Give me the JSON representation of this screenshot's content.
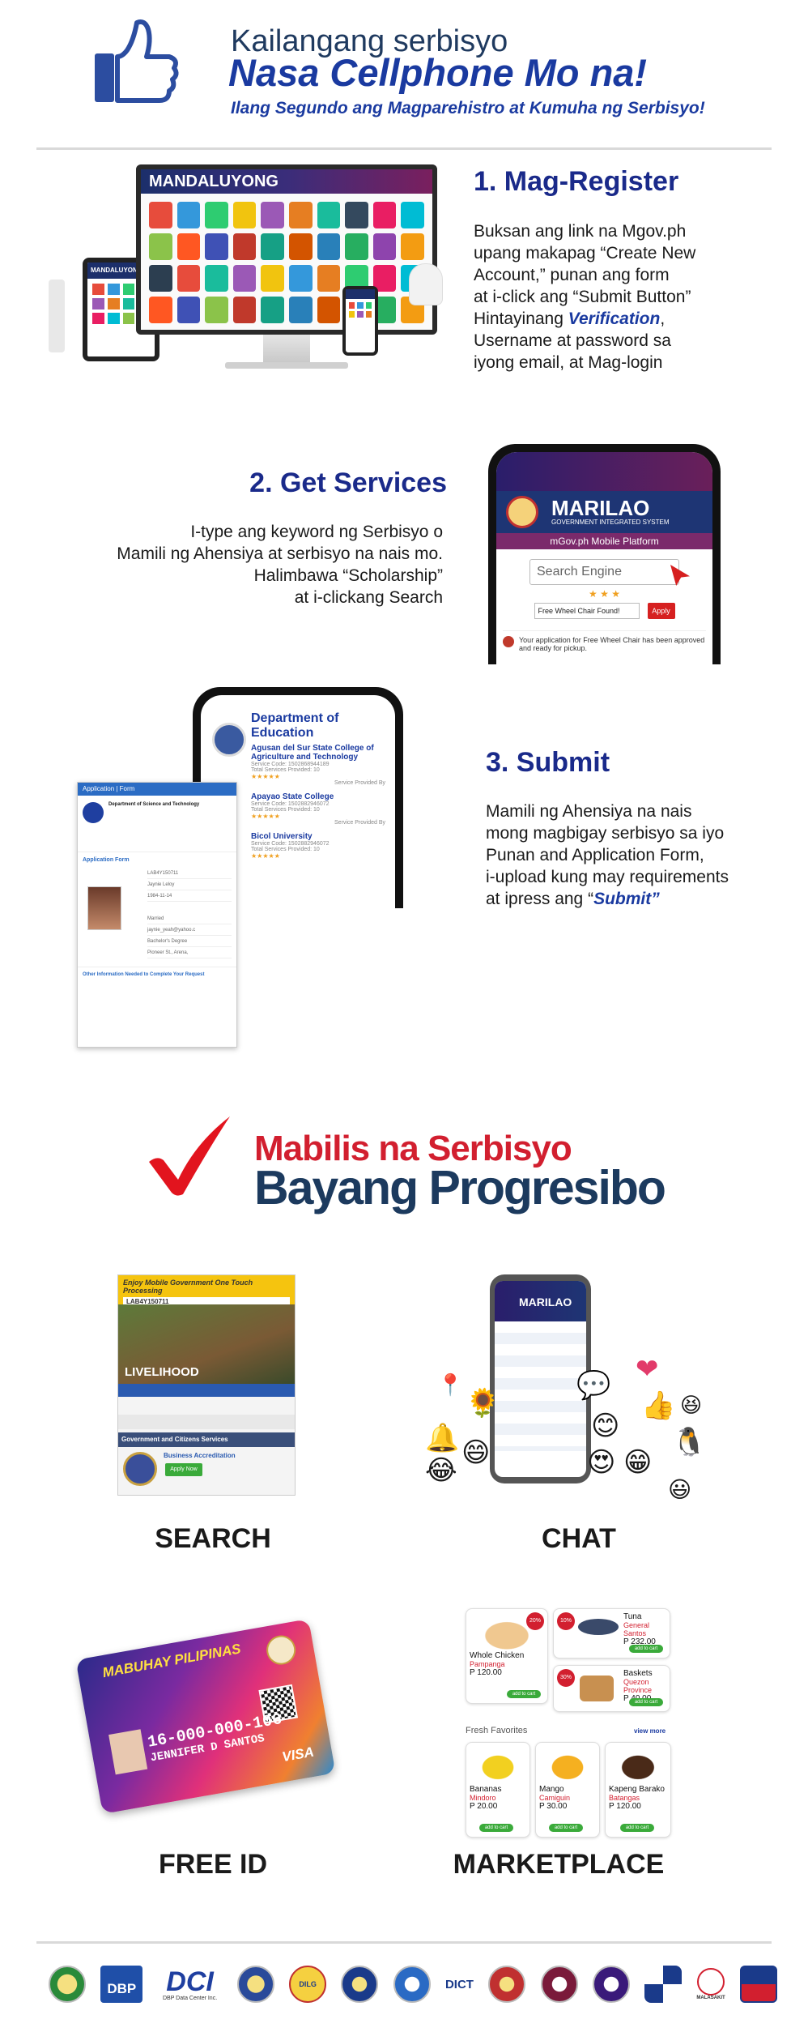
{
  "header": {
    "line1": "Kailangang serbisyo",
    "line2": "Nasa Cellphone Mo na!",
    "line3": "Ilang Segundo ang Magparehistro at Kumuha ng Serbisyo!"
  },
  "step1": {
    "title": "1.  Mag-Register",
    "lines": [
      "Buksan ang link na Mgov.ph",
      "upang makapag “Create New",
      "Account,” punan ang form",
      "at i-click ang “Submit Button”",
      "Username at password sa",
      "iyong email, at Mag-login"
    ],
    "wait_prefix": "Hintayinang ",
    "wait_em": "Verification",
    "wait_suffix": ",",
    "monitor_title": "MANDALUYONG",
    "tablet_title": "MANDALUYONG"
  },
  "step2": {
    "title": "2.  Get Services",
    "lines": [
      "I-type ang keyword ng Serbisyo o",
      "Mamili ng Ahensiya at serbisyo na nais mo.",
      "Halimbawa “Scholarship”",
      "at i-clickang Search"
    ],
    "phone": {
      "brand": "MARILAO",
      "brand_sub": "GOVERNMENT INTEGRATED SYSTEM",
      "platform": "mGov.ph Mobile Platform",
      "search_placeholder": "Search Engine",
      "stars": "★ ★ ★",
      "input_value": "Free Wheel Chair Found!",
      "apply": "Apply",
      "note": "Your application for Free Wheel Chair has been approved and ready for pickup."
    }
  },
  "step3": {
    "title": "3.  Submit",
    "lines": [
      "Mamili ng Ahensiya na nais",
      "mong magbigay serbisyo sa iyo",
      "Punan and Application Form,",
      "i-upload kung may requirements"
    ],
    "last_prefix": "at ipress ang “",
    "last_em": "Submit”",
    "phone": {
      "dept": "Department of Education",
      "items": [
        {
          "name": "Agusan del Sur State College of Agriculture and Technology",
          "code": "Service Code: 1502868944189",
          "total": "Total Services Provided: 10"
        },
        {
          "name": "Apayao State College",
          "code": "Service Code: 1502882946072",
          "total": "Total Services Provided: 10"
        },
        {
          "name": "Bicol University",
          "code": "Service Code: 1502882946072",
          "total": "Total Services Provided: 10"
        }
      ],
      "stars": "★★★★★",
      "provided_by": "Service Provided By"
    },
    "form": {
      "header": "Application | Form",
      "agency": "Department of Science and Technology",
      "section": "Application Form",
      "rows": [
        "LAB4Y150711",
        "Jaynie Leloy",
        "1984-11-14",
        "Married",
        "jaynie_yeah@yahoo.c",
        "Bachelor's Degree",
        "Pioneer St., Arena, "
      ],
      "other": "Other Information Needed to Complete Your Request"
    }
  },
  "slogan": {
    "line1": "Mabilis na Serbisyo",
    "line2": "Bayang Progresibo"
  },
  "features": {
    "search": {
      "label": "SEARCH",
      "banner": "Enjoy Mobile Government One Touch Processing",
      "code": "LAB4Y150711",
      "photo_label": "LIVELIHOOD",
      "section": "Government and Citizens Services",
      "item": "Business Accreditation",
      "apply": "Apply Now"
    },
    "chat": {
      "label": "CHAT",
      "brand": "MARILAO",
      "emojis": [
        "🌻",
        "📍",
        "❤",
        "💬",
        "👍",
        "😊",
        "😄",
        "😍",
        "😂",
        "🐧",
        "🔔",
        "😁",
        "😃",
        "😆"
      ]
    },
    "free_id": {
      "label": "FREE ID",
      "brand": "MABUHAY PILIPINAS",
      "number": "16-000-000-106",
      "name": "JENNIFER D SANTOS",
      "visa": "VISA"
    },
    "marketplace": {
      "label": "MARKETPLACE",
      "fresh": "Fresh Favorites",
      "view_more": "view more",
      "add_to_cart": "add to cart",
      "items": [
        {
          "name": "Whole Chicken",
          "origin": "Pampanga",
          "price": "P 120.00",
          "badge": "20%"
        },
        {
          "name": "Tuna",
          "origin": "General Santos",
          "price": "P 232.00",
          "badge": "10%"
        },
        {
          "name": "Baskets",
          "origin": "Quezon Province",
          "price": "P 40.00",
          "badge": "30%"
        },
        {
          "name": "Bananas",
          "origin": "Mindoro",
          "price": "P 20.00"
        },
        {
          "name": "Mango",
          "origin": "Camiguin",
          "price": "P 30.00"
        },
        {
          "name": "Kapeng Barako",
          "origin": "Batangas",
          "price": "P 120.00"
        }
      ]
    }
  },
  "logos": {
    "dbp": "DBP",
    "dci": "DCI",
    "dci_sub": "DBP Data Center Inc.",
    "dilg": "DILG",
    "dict": "DICT",
    "malasakit": "MALASAKIT"
  },
  "colors": {
    "navy": "#1a2a8a",
    "accent_blue": "#1a3aa0",
    "red": "#d21f2f",
    "slogan_navy": "#1c3a5e"
  }
}
